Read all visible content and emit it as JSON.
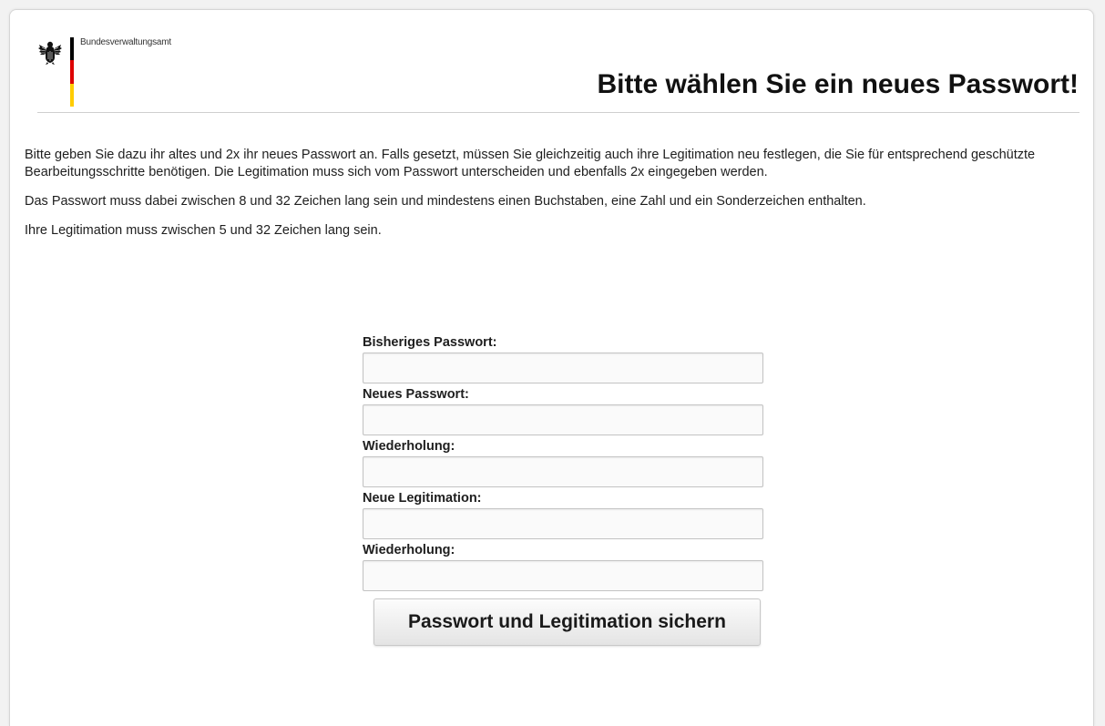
{
  "header": {
    "agency_name": "Bundesverwaltungsamt",
    "title": "Bitte wählen Sie ein neues Passwort!",
    "flag_colors": [
      "#000000",
      "#dd0000",
      "#ffcc00"
    ],
    "emblem_icon": "federal-eagle-icon"
  },
  "intro": {
    "paragraph1": "Bitte geben Sie dazu ihr altes und 2x ihr neues Passwort an. Falls gesetzt, müssen Sie gleichzeitig auch ihre Legitimation neu festlegen, die Sie für entsprechend geschützte Bearbeitungsschritte benötigen. Die Legitimation muss sich vom Passwort unterscheiden und ebenfalls 2x eingegeben werden.",
    "paragraph2": "Das Passwort muss dabei zwischen 8 und 32 Zeichen lang sein und mindestens einen Buchstaben, eine Zahl und ein Sonderzeichen enthalten.",
    "paragraph3": "Ihre Legitimation muss zwischen 5 und 32 Zeichen lang sein."
  },
  "form": {
    "old_password": {
      "label": "Bisheriges Passwort:",
      "value": ""
    },
    "new_password": {
      "label": "Neues Passwort:",
      "value": ""
    },
    "new_password_repeat": {
      "label": "Wiederholung:",
      "value": ""
    },
    "new_legitimation": {
      "label": "Neue Legitimation:",
      "value": ""
    },
    "new_legitimation_repeat": {
      "label": "Wiederholung:",
      "value": ""
    },
    "submit_label": "Passwort und Legitimation sichern"
  }
}
